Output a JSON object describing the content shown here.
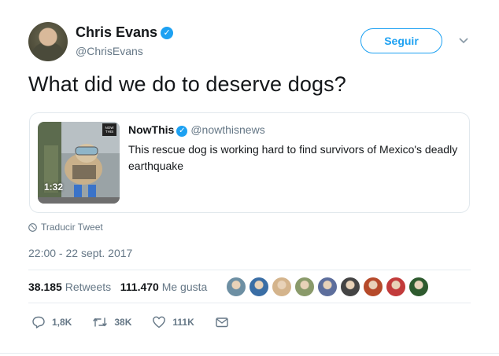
{
  "author": {
    "name": "Chris Evans",
    "handle": "@ChrisEvans",
    "verified_icon": "verified-badge-icon"
  },
  "follow_button": {
    "label": "Seguir"
  },
  "tweet": {
    "text": "What did we do to deserve dogs?"
  },
  "quoted": {
    "name": "NowThis",
    "handle": "@nowthisnews",
    "text": "This rescue dog is working hard to find survivors of Mexico's deadly earthquake",
    "video_duration": "1:32",
    "thumbnail_badge": "NOW THIS"
  },
  "translate": {
    "label": "Traducir Tweet",
    "icon": "globe-icon"
  },
  "timestamp": "22:00 - 22 sept. 2017",
  "stats": {
    "retweets_count": "38.185",
    "retweets_label": "Retweets",
    "likes_count": "111.470",
    "likes_label": "Me gusta"
  },
  "likers_colors": [
    "#6d8fa3",
    "#3a6ea5",
    "#d4b48c",
    "#8a9a6a",
    "#5d6e9c",
    "#444444",
    "#b64a2a",
    "#c23b3b",
    "#2e5a2e"
  ],
  "actions": {
    "reply_count": "1,8K",
    "retweet_count": "38K",
    "like_count": "111K"
  },
  "colors": {
    "accent": "#1da1f2",
    "muted": "#657786",
    "text": "#14171a"
  }
}
